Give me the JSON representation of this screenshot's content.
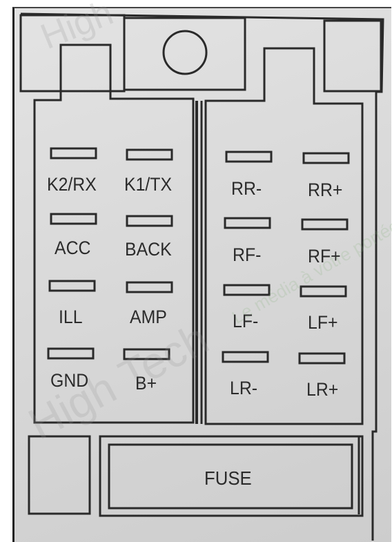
{
  "connector": {
    "left_block": {
      "pins": [
        {
          "label": "K2/RX"
        },
        {
          "label": "K1/TX"
        },
        {
          "label": "ACC"
        },
        {
          "label": "BACK"
        },
        {
          "label": "ILL"
        },
        {
          "label": "AMP"
        },
        {
          "label": "GND"
        },
        {
          "label": "B+"
        }
      ]
    },
    "right_block": {
      "pins": [
        {
          "label": "RR-"
        },
        {
          "label": "RR+"
        },
        {
          "label": "RF-"
        },
        {
          "label": "RF+"
        },
        {
          "label": "LF-"
        },
        {
          "label": "LF+"
        },
        {
          "label": "LR-"
        },
        {
          "label": "LR+"
        }
      ]
    },
    "fuse": {
      "label": "FUSE"
    }
  },
  "watermark": {
    "brand": "High Tech",
    "tagline": "Le média à votre portée"
  },
  "colors": {
    "background": "#d9d9d9",
    "line": "#2a2a2a",
    "text": "#2b2b2b"
  }
}
